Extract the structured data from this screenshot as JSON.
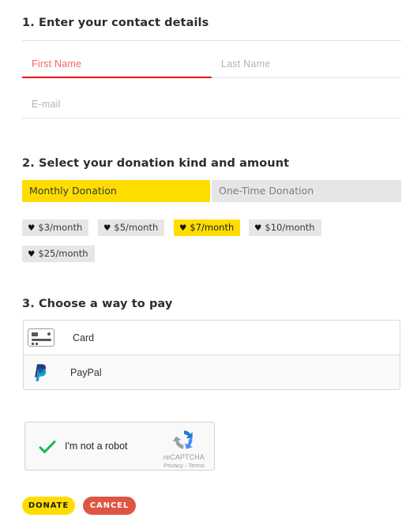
{
  "form": {
    "steps": [
      {
        "title": "1. Enter your contact details"
      },
      {
        "title": "2. Select your donation kind and amount"
      },
      {
        "title": "3. Choose a way to pay"
      }
    ]
  },
  "contact": {
    "first_name": {
      "placeholder": "First Name",
      "value": "",
      "state": "error"
    },
    "last_name": {
      "placeholder": "Last Name",
      "value": ""
    },
    "email": {
      "placeholder": "E-mail",
      "value": ""
    }
  },
  "donation": {
    "kinds": [
      {
        "label": "Monthly Donation",
        "selected": true
      },
      {
        "label": "One-Time Donation",
        "selected": false
      }
    ],
    "amounts": [
      {
        "label": "$3/month",
        "selected": false
      },
      {
        "label": "$5/month",
        "selected": false
      },
      {
        "label": "$7/month",
        "selected": true
      },
      {
        "label": "$10/month",
        "selected": false
      },
      {
        "label": "$25/month",
        "selected": false
      }
    ],
    "heart_glyph": "♥"
  },
  "payment": {
    "methods": [
      {
        "label": "Card",
        "icon": "credit-card-icon",
        "selected": true
      },
      {
        "label": "PayPal",
        "icon": "paypal-icon",
        "selected": false
      }
    ]
  },
  "recaptcha": {
    "label": "I'm not a robot",
    "checked": true,
    "brand": "reCAPTCHA",
    "links": "Privacy - Terms"
  },
  "actions": {
    "donate_label": "DONATE",
    "cancel_label": "CANCEL"
  },
  "colors": {
    "accent_yellow": "#ffdd00",
    "cancel_red": "#df5543",
    "error_red": "#e8140c",
    "chip_grey": "#e6e6e6",
    "text_dark": "#2c2c2c"
  }
}
